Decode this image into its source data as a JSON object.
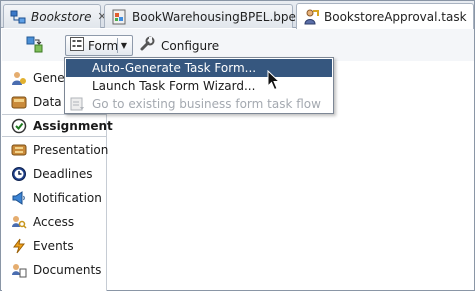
{
  "tabs": [
    {
      "label": "Bookstore",
      "italic": true,
      "icon": "composite-icon",
      "close": "✕"
    },
    {
      "label": "BookWarehousingBPEL.bpel",
      "italic": false,
      "icon": "bpel-process-icon",
      "close": "✕"
    },
    {
      "label": "BookstoreApproval.task",
      "italic": false,
      "icon": "human-task-icon",
      "active": true
    }
  ],
  "toolbar": {
    "form_label": "Form",
    "form_dropdown_glyph": "▼",
    "configure_label": "Configure",
    "icons": [
      "task-settings-icon",
      "form-icon",
      "wrench-icon"
    ]
  },
  "form_menu": [
    {
      "label": "Auto-Generate Task Form...",
      "state": "highlighted"
    },
    {
      "label": "Launch Task Form Wizard...",
      "state": "enabled"
    },
    {
      "label": "Go to existing business form task flow",
      "state": "disabled"
    }
  ],
  "sidenav": [
    {
      "label": "General",
      "icon": "general-icon"
    },
    {
      "label": "Data",
      "icon": "data-icon"
    },
    {
      "label": "Assignment",
      "icon": "assignment-icon",
      "selected": true
    },
    {
      "label": "Presentation",
      "icon": "presentation-icon"
    },
    {
      "label": "Deadlines",
      "icon": "deadlines-icon"
    },
    {
      "label": "Notification",
      "icon": "notification-icon"
    },
    {
      "label": "Access",
      "icon": "access-icon"
    },
    {
      "label": "Events",
      "icon": "events-icon"
    },
    {
      "label": "Documents",
      "icon": "documents-icon"
    }
  ],
  "colors": {
    "menu_highlight": "#36577f",
    "tab_border": "#a9b3c1",
    "disabled_text": "#a4a9b0"
  }
}
